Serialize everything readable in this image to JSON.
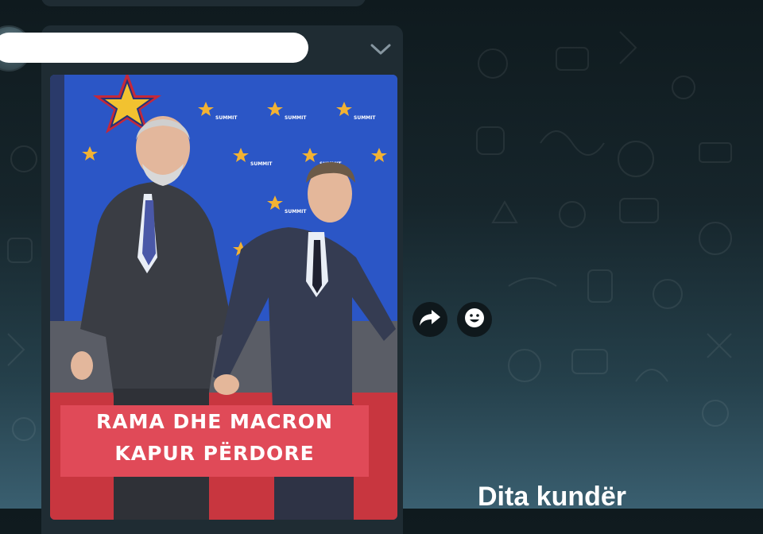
{
  "chat": {
    "message": {
      "sender_name": "",
      "media_caption_line1": "RAMA DHE MACRON",
      "media_caption_line2": "KAPUR PËRDORE",
      "banner_label": "SUMMIT"
    },
    "actions": {
      "forward_icon": "forward-arrow-icon",
      "react_icon": "smiley-icon"
    },
    "next_message_preview": "Dita kundër"
  },
  "colors": {
    "bubble": "#1f2c33",
    "backdrop_blue": "#2b56c6",
    "carpet_red": "#d8424f",
    "accent_white": "#ffffff"
  }
}
